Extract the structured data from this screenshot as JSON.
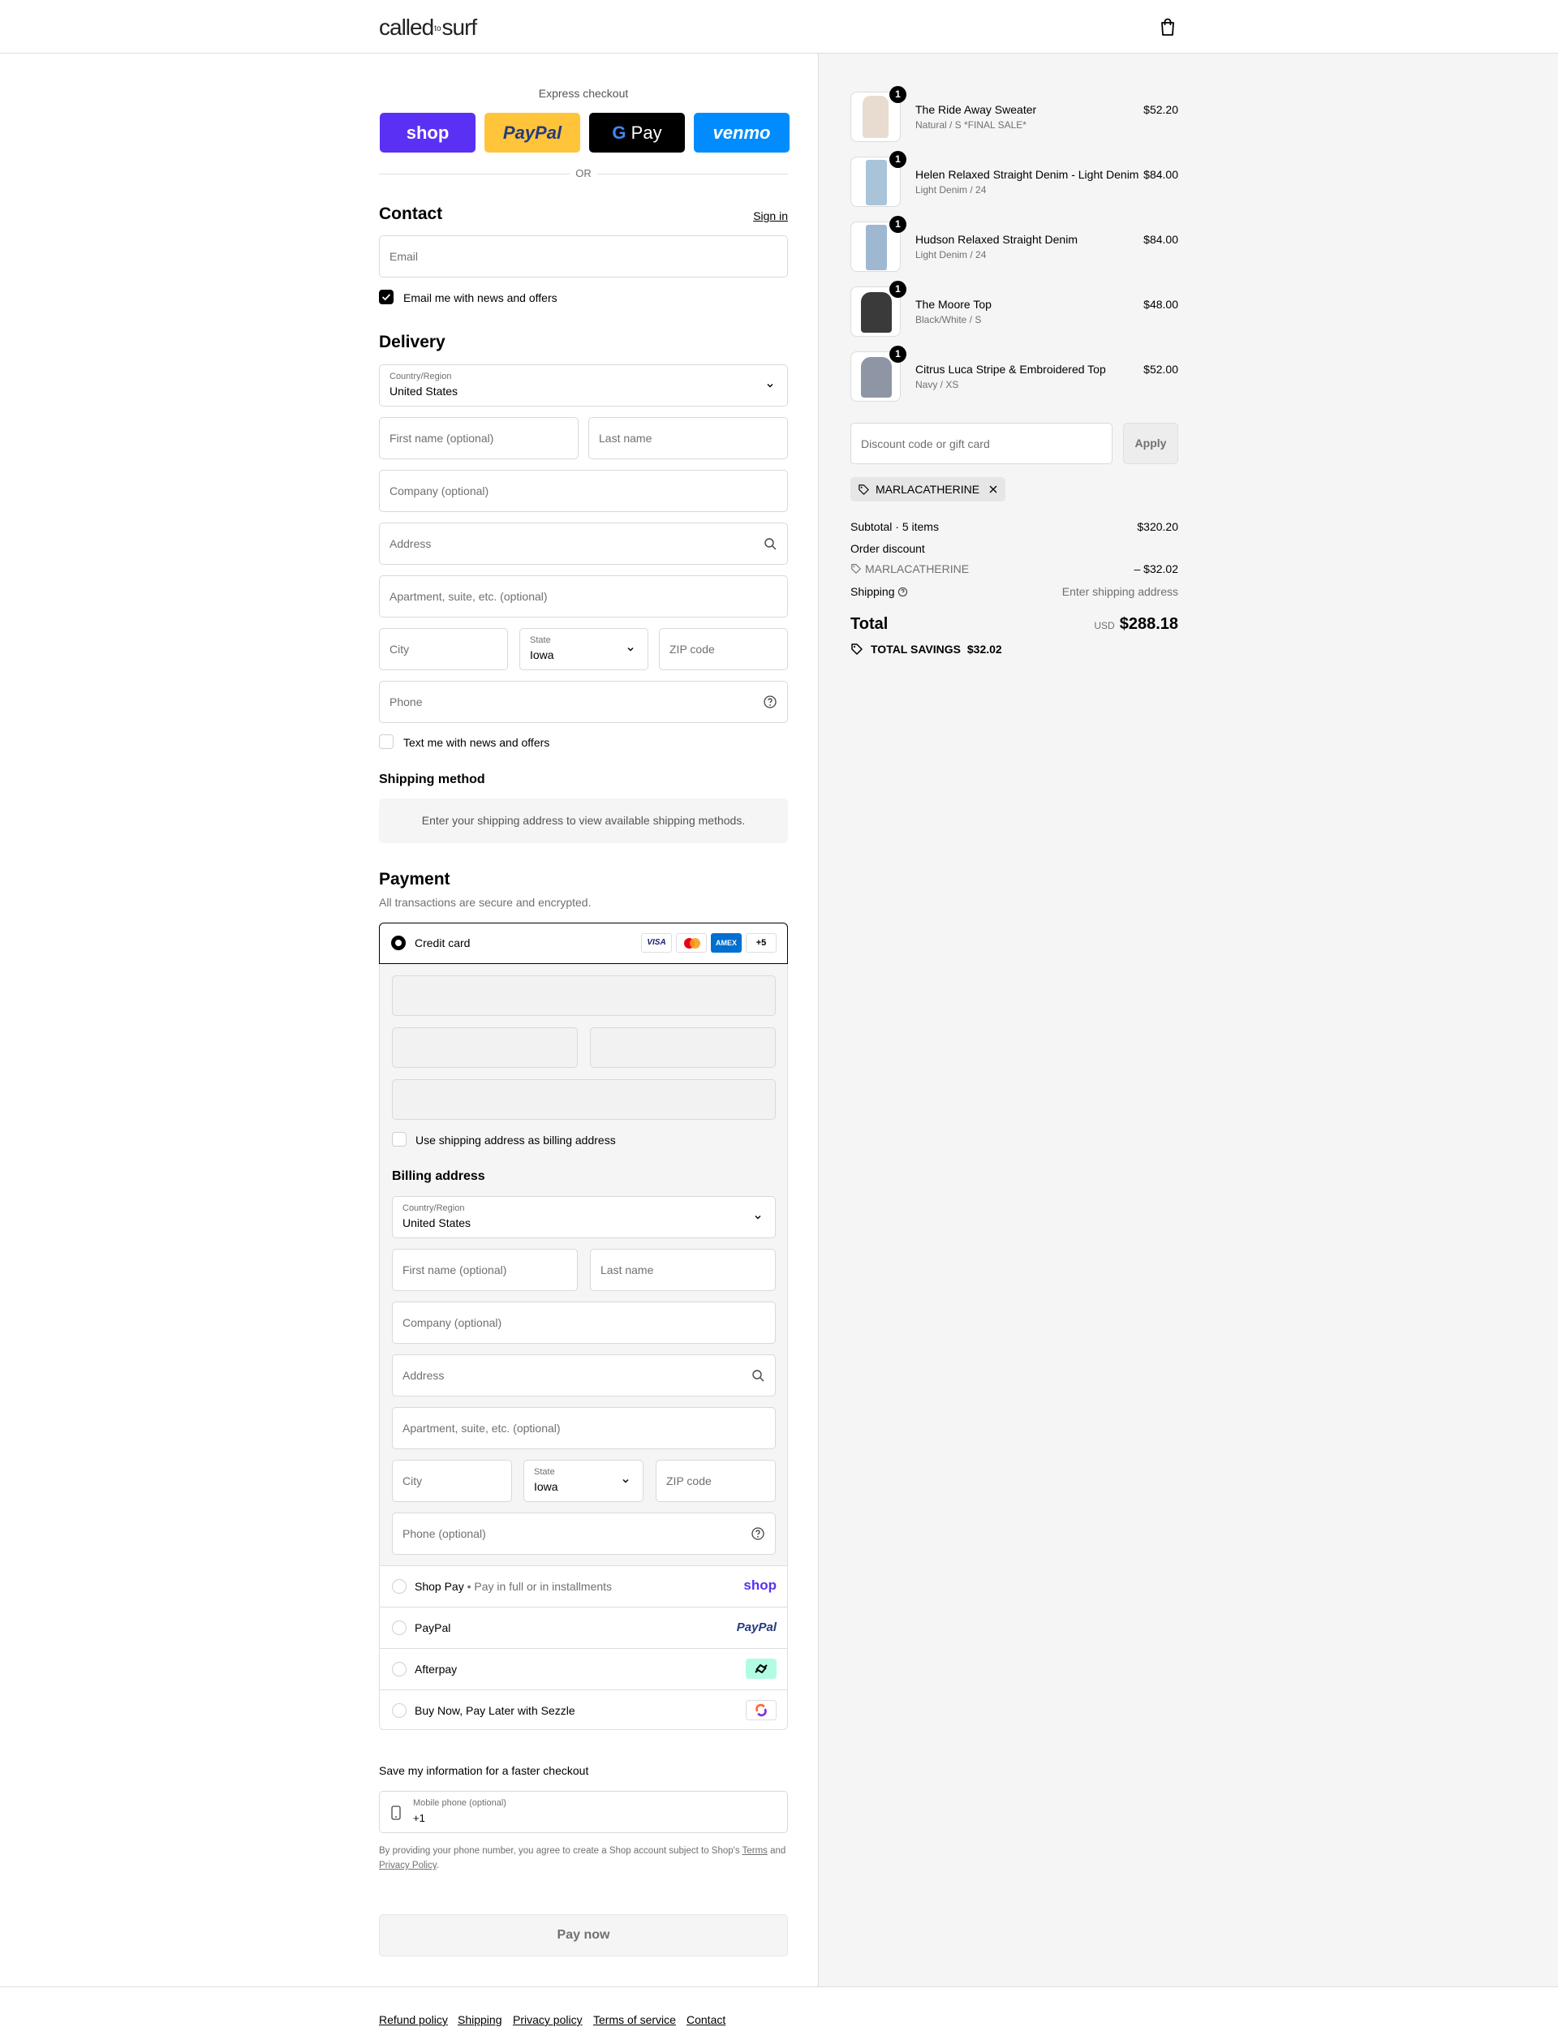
{
  "brand": {
    "logo_left": "called",
    "logo_mid": "to",
    "logo_right": "surf"
  },
  "express": {
    "heading": "Express checkout",
    "or": "OR",
    "buttons": {
      "shop": "shop",
      "paypal": "PayPal",
      "gpay": "Pay",
      "venmo": "venmo"
    }
  },
  "contact": {
    "title": "Contact",
    "sign_in": "Sign in",
    "email_placeholder": "Email",
    "news_label": "Email me with news and offers",
    "news_checked": true
  },
  "delivery": {
    "title": "Delivery",
    "country_label": "Country/Region",
    "country_value": "United States",
    "first_name": "First name (optional)",
    "last_name": "Last name",
    "company": "Company (optional)",
    "address": "Address",
    "apartment": "Apartment, suite, etc. (optional)",
    "city": "City",
    "state_label": "State",
    "state_value": "Iowa",
    "zip": "ZIP code",
    "phone": "Phone",
    "text_label": "Text me with news and offers"
  },
  "shipping_method": {
    "title": "Shipping method",
    "message": "Enter your shipping address to view available shipping methods."
  },
  "payment": {
    "title": "Payment",
    "subtitle": "All transactions are secure and encrypted.",
    "credit_card": "Credit card",
    "card_badges": {
      "visa": "VISA",
      "amex": "AMEX",
      "more": "+5"
    },
    "use_shipping": "Use shipping address as billing address",
    "billing_title": "Billing address",
    "billing": {
      "country_label": "Country/Region",
      "country_value": "United States",
      "first_name": "First name (optional)",
      "last_name": "Last name",
      "company": "Company (optional)",
      "address": "Address",
      "apartment": "Apartment, suite, etc. (optional)",
      "city": "City",
      "state_label": "State",
      "state_value": "Iowa",
      "zip": "ZIP code",
      "phone": "Phone (optional)"
    },
    "methods": [
      {
        "label": "Shop Pay",
        "sub": "Pay in full or in installments",
        "logo": "shop"
      },
      {
        "label": "PayPal",
        "logo": "PayPal"
      },
      {
        "label": "Afterpay",
        "logo": "afterpay-icon"
      },
      {
        "label": "Buy Now, Pay Later with Sezzle",
        "logo": "sezzle-icon"
      }
    ]
  },
  "save_info": {
    "title": "Save my information for a faster checkout",
    "mobile_label": "Mobile phone (optional)",
    "mobile_value": "+1",
    "legal_prefix": "By providing your phone number, you agree to create a Shop account subject to Shop's",
    "terms": "Terms",
    "and": "and",
    "privacy": "Privacy Policy",
    "period": "."
  },
  "pay_now": "Pay now",
  "footer_links": [
    "Refund policy",
    "Shipping",
    "Privacy policy",
    "Terms of service",
    "Contact"
  ],
  "cart": {
    "items": [
      {
        "name": "The Ride Away Sweater",
        "variant": "Natural / S *FINAL SALE*",
        "price": "$52.20",
        "qty": "1",
        "thumb_color": "#e8dcd0"
      },
      {
        "name": "Helen Relaxed Straight Denim - Light Denim",
        "variant": "Light Denim / 24",
        "price": "$84.00",
        "qty": "1",
        "thumb_color": "#a9c3d9"
      },
      {
        "name": "Hudson Relaxed Straight Denim",
        "variant": "Light Denim / 24",
        "price": "$84.00",
        "qty": "1",
        "thumb_color": "#9fb8d2"
      },
      {
        "name": "The Moore Top",
        "variant": "Black/White / S",
        "price": "$48.00",
        "qty": "1",
        "thumb_color": "#3a3a3a"
      },
      {
        "name": "Citrus Luca Stripe & Embroidered Top",
        "variant": "Navy / XS",
        "price": "$52.00",
        "qty": "1",
        "thumb_color": "#8e96a6"
      }
    ],
    "discount_placeholder": "Discount code or gift card",
    "apply": "Apply",
    "applied_code": "MARLACATHERINE",
    "subtotal_label": "Subtotal · 5 items",
    "subtotal_value": "$320.20",
    "order_discount_label": "Order discount",
    "discount_code": "MARLACATHERINE",
    "discount_value": "– $32.02",
    "shipping_label": "Shipping",
    "shipping_value": "Enter shipping address",
    "total_label": "Total",
    "currency": "USD",
    "total_value": "$288.18",
    "savings_label": "TOTAL SAVINGS",
    "savings_value": "$32.02"
  }
}
